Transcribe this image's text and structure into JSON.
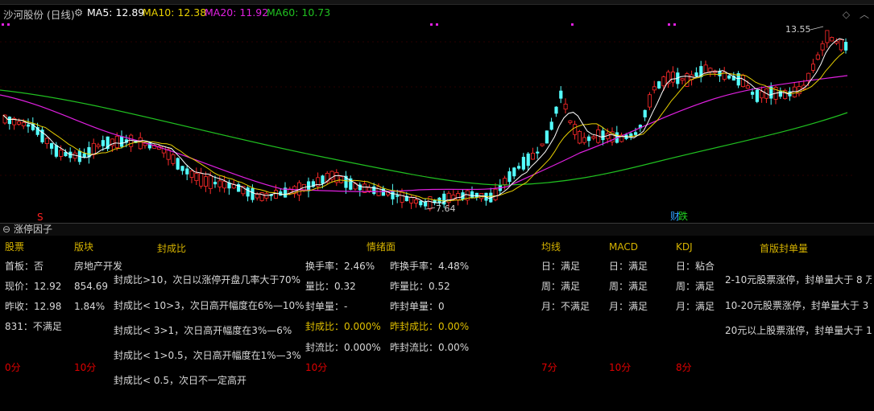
{
  "chart": {
    "title": "沙河股份 (日线)",
    "ma_labels": [
      "MA5: 12.89",
      "MA10: 12.38",
      "MA20: 11.92",
      "MA60: 10.73"
    ],
    "ma_colors": [
      "#ffffff",
      "#e8d000",
      "#e020e0",
      "#20c020"
    ],
    "high_label": "13.55",
    "low_label": "7.64",
    "marker_s": "S",
    "marker_cai": "财",
    "marker_die": "跌",
    "up_color": "#ff2a2a",
    "down_color": "#54ffff"
  },
  "panel": {
    "title": "涨停因子",
    "headers": {
      "stock": "股票",
      "sector": "版块",
      "seal_ratio": "封成比",
      "sentiment": "情绪面",
      "ma": "均线",
      "macd": "MACD",
      "kdj": "KDJ",
      "first_board": "首版封单量"
    },
    "stock": [
      "首板：否",
      "现价：12.92",
      "昨收：12.98",
      "831：不满足"
    ],
    "stock_score": "0分",
    "sector": [
      "房地产开发",
      "854.69",
      "1.84%"
    ],
    "sector_score": "10分",
    "seal_rules": [
      "封成比>10，次日以涨停开盘几率大于70%",
      "封成比< 10>3，次日高开幅度在6%—10%",
      "封成比< 3>1，次日高开幅度在3%—6%",
      "封成比< 1>0.5，次日高开幅度在1%—3%",
      "封成比< 0.5，次日不一定高开"
    ],
    "sentiment_left": [
      "换手率：2.46%",
      "量比：0.32",
      "封单量：-",
      "封成比：0.000%",
      "封流比：0.000%"
    ],
    "sentiment_right": [
      "昨换手率：4.48%",
      "昨量比：0.52",
      "昨封单量：0",
      "昨封成比：0.00%",
      "昨封流比：0.00%"
    ],
    "sentiment_score": "10分",
    "ma": [
      "日：满足",
      "周：满足",
      "月：不满足"
    ],
    "ma_score": "7分",
    "macd": [
      "日：满足",
      "周：满足",
      "月：满足"
    ],
    "macd_score": "10分",
    "kdj": [
      "日：粘合",
      "周：满足",
      "月：满足"
    ],
    "kdj_score": "8分",
    "first_board": [
      "2-10元股票涨停，封单量大于 8 万",
      "10-20元股票涨停，封单量大于 3 万",
      "20元以上股票涨停，封单量大于 1"
    ]
  }
}
